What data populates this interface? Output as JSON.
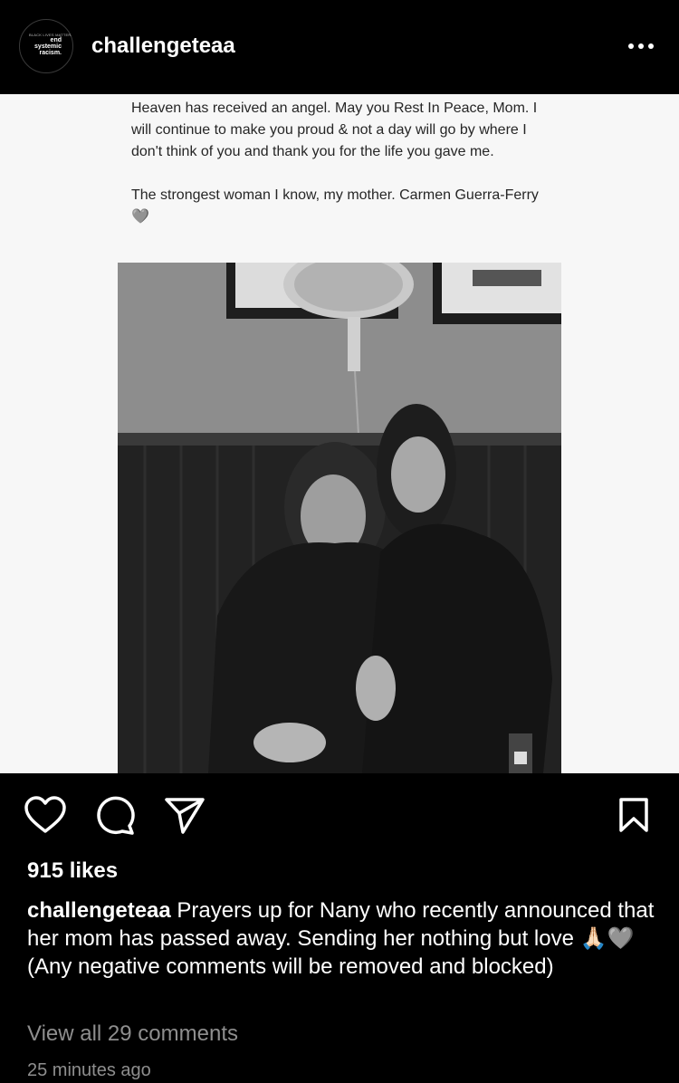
{
  "header": {
    "username": "challengeteaa",
    "avatar_small_text": "BLACK LIVES MATTER.",
    "avatar_lines": [
      "end",
      "systemic",
      "racism."
    ]
  },
  "post_image": {
    "text_lines": [
      "Heaven has received an angel. May you Rest In Peace, Mom. I will continue to make you proud & not a day will go by where I don't think of you and thank you for the life you gave me.",
      "The strongest woman I know, my mother. Carmen Guerra-Ferry 🩶"
    ]
  },
  "actions": {
    "like": "heart-icon",
    "comment": "comment-icon",
    "share": "send-icon",
    "save": "bookmark-icon"
  },
  "likes": "915 likes",
  "caption": {
    "username": "challengeteaa",
    "text": " Prayers up for Nany who recently announced that her mom has passed away. Sending her nothing but love 🙏🏻🩶 (Any negative comments will be removed and blocked)"
  },
  "view_comments": "View all 29 comments",
  "timestamp": "25 minutes ago"
}
